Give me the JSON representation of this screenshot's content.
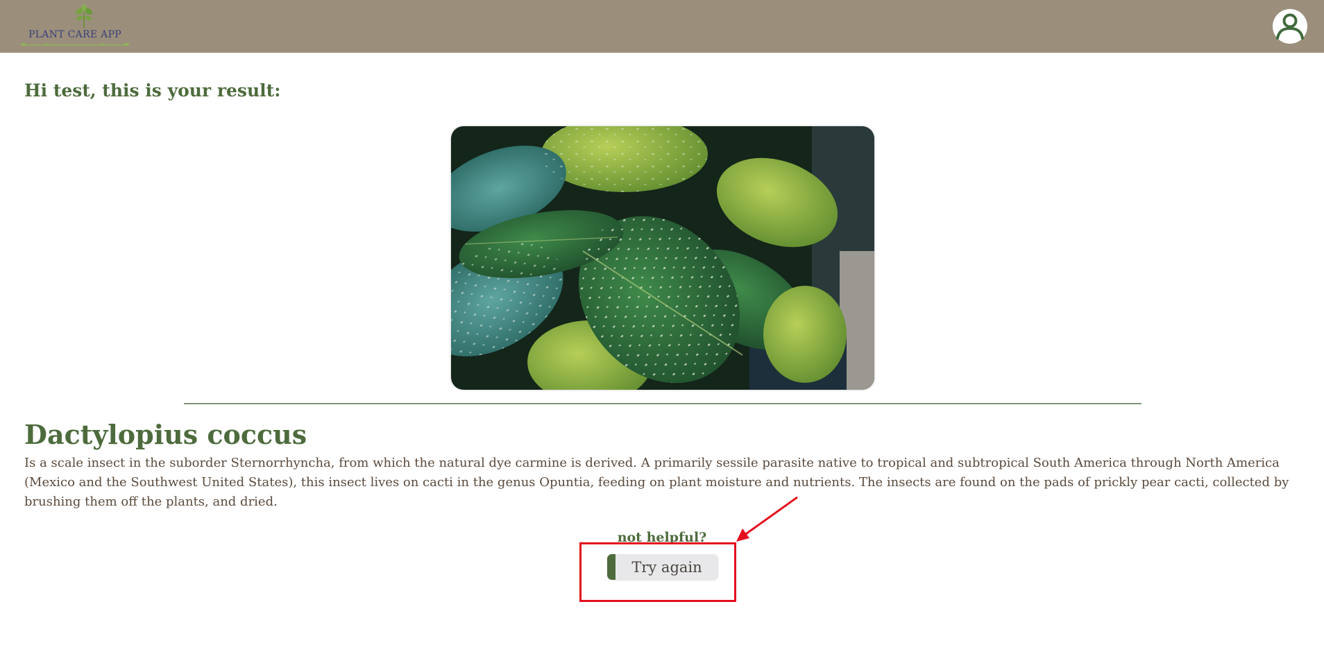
{
  "header": {
    "logo_text": "PLANT CARE APP",
    "profile_icon": "user-profile-icon",
    "background_color": "#9b8f7c"
  },
  "main": {
    "greeting": "Hi test, this is your result:",
    "image_icon": "plant-leaves-photo",
    "species_name": "Dactylopius coccus",
    "description": "Is a scale insect in the suborder Sternorrhyncha, from which the natural dye carmine is derived. A primarily sessile parasite native to tropical and subtropical South America through North America (Mexico and the Southwest United States), this insect lives on cacti in the genus Opuntia, feeding on plant moisture and nutrients. The insects are found on the pads of prickly pear cacti, collected by brushing them off the plants, and dried.",
    "not_helpful_label": "not helpful?",
    "try_again_label": "Try again"
  },
  "annotation": {
    "highlight_color": "#e3101e"
  },
  "colors": {
    "accent_green": "#4d6b3c",
    "body_text": "#5a4a3c",
    "logo_text": "#3b3f79"
  }
}
